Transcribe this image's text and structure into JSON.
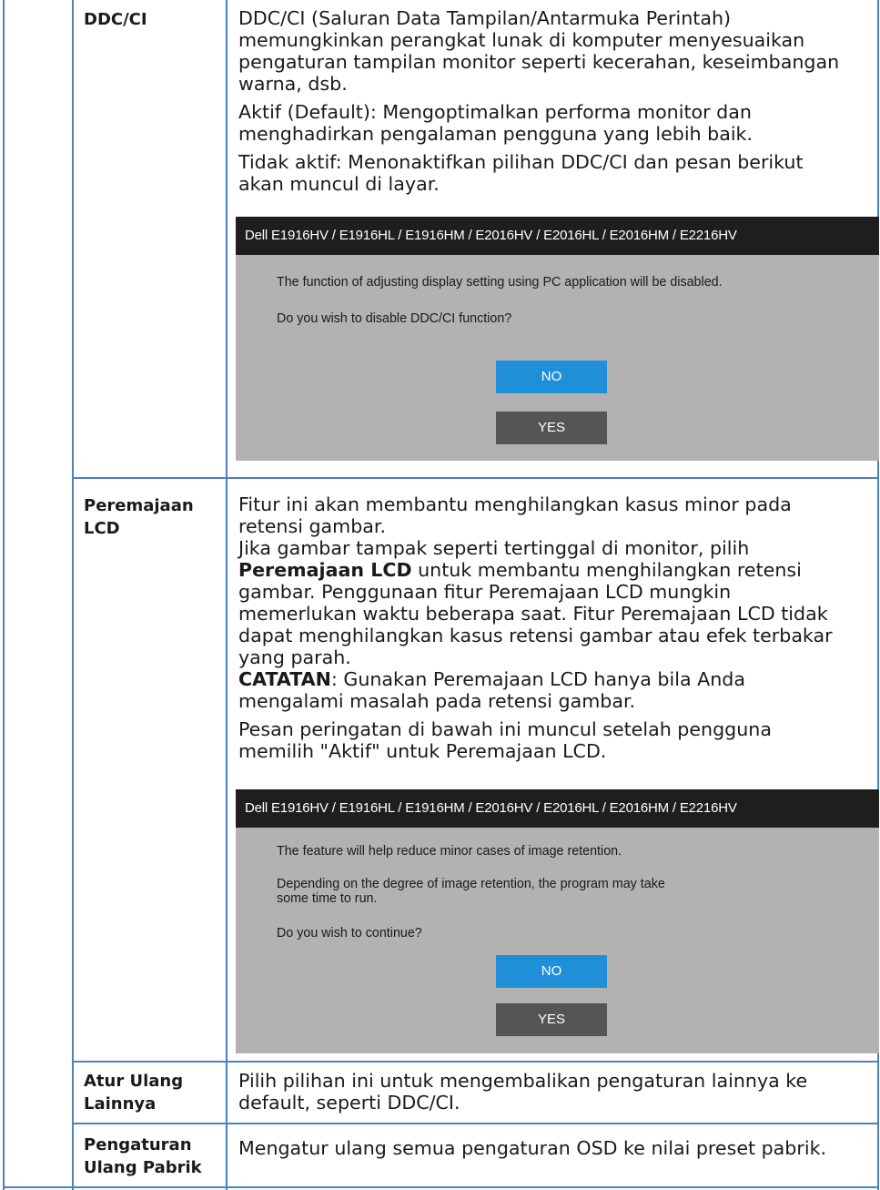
{
  "colors": {
    "border": "#4f81bd",
    "dialog_bg": "#b2b2b2",
    "dialog_titlebar": "#1e1e1e",
    "no_button": "#1f90d8",
    "yes_button": "#555555"
  },
  "rows": {
    "ddcci": {
      "label": "DDC/CI",
      "para1_lines": [
        "DDC/CI (Saluran Data Tampilan/Antarmuka Perintah)",
        "memungkinkan perangkat lunak di komputer menyesuaikan",
        "pengaturan tampilan monitor seperti kecerahan, keseimbangan",
        "warna, dsb."
      ],
      "para2_lines": [
        "Aktif (Default): Mengoptimalkan performa monitor dan",
        "menghadirkan pengalaman pengguna yang lebih baik."
      ],
      "para3_lines": [
        "Tidak aktif: Menonaktifkan pilihan DDC/CI dan pesan berikut",
        "akan muncul di layar."
      ],
      "dialog": {
        "title": "Dell E1916HV / E1916HL / E1916HM / E2016HV / E2016HL / E2016HM / E2216HV",
        "message1": "The function of adjusting display setting using PC application will be disabled.",
        "message2": "Do you wish to disable DDC/CI function?",
        "no_label": "NO",
        "yes_label": "YES"
      }
    },
    "lcd": {
      "label_line1": "Peremajaan",
      "label_line2": "LCD",
      "lines": [
        "Fitur ini akan membantu menghilangkan kasus minor pada",
        "retensi gambar.",
        "Jika gambar tampak seperti tertinggal di monitor, pilih"
      ],
      "bold_term": "Peremajaan LCD",
      "after_bold": " untuk membantu menghilangkan retensi",
      "lines2": [
        "gambar. Penggunaan fitur Peremajaan LCD mungkin",
        "memerlukan waktu beberapa saat. Fitur Peremajaan LCD tidak",
        "dapat menghilangkan kasus retensi gambar atau efek terbakar",
        "yang parah."
      ],
      "note_label": "CATATAN",
      "note_text": ": Gunakan Peremajaan LCD hanya bila Anda",
      "note_line2": "mengalami masalah pada retensi gambar.",
      "warning_lines": [
        "Pesan peringatan di bawah ini muncul setelah pengguna",
        "memilih \"Aktif\" untuk Peremajaan LCD."
      ],
      "dialog": {
        "title": "Dell E1916HV / E1916HL / E1916HM / E2016HV / E2016HL / E2016HM / E2216HV",
        "message1": "The feature will help reduce minor cases of image retention.",
        "message2_line1": "Depending on the degree of image retention, the program may take",
        "message2_line2": "some time to run.",
        "message3": "Do you wish to continue?",
        "no_label": "NO",
        "yes_label": "YES"
      }
    },
    "reset_other": {
      "label_line1": "Atur Ulang",
      "label_line2": "Lainnya",
      "lines": [
        "Pilih pilihan ini untuk mengembalikan pengaturan lainnya ke",
        "default, seperti DDC/CI."
      ]
    },
    "factory_reset": {
      "label_line1": "Pengaturan",
      "label_line2": "Ulang Pabrik",
      "text": "Mengatur ulang semua pengaturan OSD ke nilai preset pabrik."
    }
  }
}
